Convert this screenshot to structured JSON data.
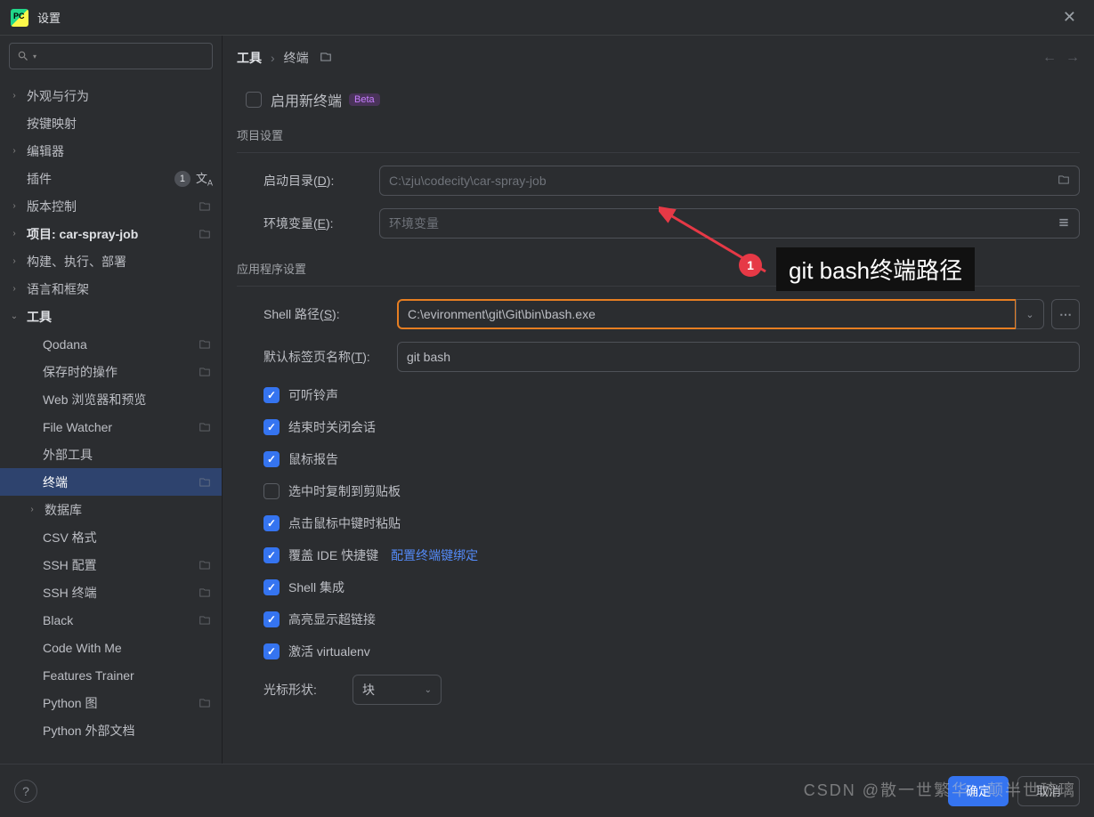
{
  "titlebar": {
    "title": "设置"
  },
  "sidebar": {
    "items": [
      {
        "label": "外观与行为",
        "arrow": ">"
      },
      {
        "label": "按键映射",
        "arrow": ""
      },
      {
        "label": "编辑器",
        "arrow": ">"
      },
      {
        "label": "插件",
        "arrow": "",
        "badge": "1",
        "lang": true
      },
      {
        "label": "版本控制",
        "arrow": ">",
        "proj": true
      },
      {
        "label": "项目: car-spray-job",
        "arrow": ">",
        "proj": true,
        "bold": true
      },
      {
        "label": "构建、执行、部署",
        "arrow": ">"
      },
      {
        "label": "语言和框架",
        "arrow": ">"
      },
      {
        "label": "工具",
        "arrow": "v",
        "open": true,
        "bold": true
      },
      {
        "label": "Qodana",
        "depth": 1,
        "proj": true
      },
      {
        "label": "保存时的操作",
        "depth": 1,
        "proj": true
      },
      {
        "label": "Web 浏览器和预览",
        "depth": 1
      },
      {
        "label": "File Watcher",
        "depth": 1,
        "proj": true
      },
      {
        "label": "外部工具",
        "depth": 1
      },
      {
        "label": "终端",
        "depth": 1,
        "proj": true,
        "selected": true
      },
      {
        "label": "数据库",
        "depth": 1,
        "arrow": ">",
        "has_arrow": true
      },
      {
        "label": "CSV 格式",
        "depth": 1
      },
      {
        "label": "SSH 配置",
        "depth": 1,
        "proj": true
      },
      {
        "label": "SSH 终端",
        "depth": 1,
        "proj": true
      },
      {
        "label": "Black",
        "depth": 1,
        "proj": true
      },
      {
        "label": "Code With Me",
        "depth": 1
      },
      {
        "label": "Features Trainer",
        "depth": 1
      },
      {
        "label": "Python 图",
        "depth": 1,
        "proj": true
      },
      {
        "label": "Python 外部文档",
        "depth": 1
      }
    ]
  },
  "breadcrumb": {
    "root": "工具",
    "leaf": "终端"
  },
  "form": {
    "enable_new_terminal": "启用新终端",
    "beta": "Beta",
    "section1": "项目设置",
    "startup_dir_label": "启动目录(D):",
    "startup_dir_value": "C:\\zju\\codecity\\car-spray-job",
    "env_label": "环境变量(E):",
    "env_placeholder": "环境变量",
    "section2": "应用程序设置",
    "shell_label": "Shell 路径(S):",
    "shell_value": "C:\\evironment\\git\\Git\\bin\\bash.exe",
    "tab_name_label": "默认标签页名称(T):",
    "tab_name_value": "git bash",
    "checks": [
      {
        "label": "可听铃声",
        "checked": true
      },
      {
        "label": "结束时关闭会话",
        "checked": true
      },
      {
        "label": "鼠标报告",
        "checked": true
      },
      {
        "label": "选中时复制到剪贴板",
        "checked": false
      },
      {
        "label": "点击鼠标中键时粘贴",
        "checked": true
      },
      {
        "label": "覆盖 IDE 快捷键",
        "checked": true,
        "link": "配置终端键绑定"
      },
      {
        "label": "Shell 集成",
        "checked": true
      },
      {
        "label": "高亮显示超链接",
        "checked": true
      },
      {
        "label": "激活 virtualenv",
        "checked": true
      }
    ],
    "cursor_label": "光标形状:",
    "cursor_value": "块"
  },
  "footer": {
    "ok": "确定",
    "cancel": "取消"
  },
  "annotation": {
    "num": "1",
    "text": "git bash终端路径"
  },
  "watermark": "CSDN @散一世繁华，颠半世琉璃"
}
